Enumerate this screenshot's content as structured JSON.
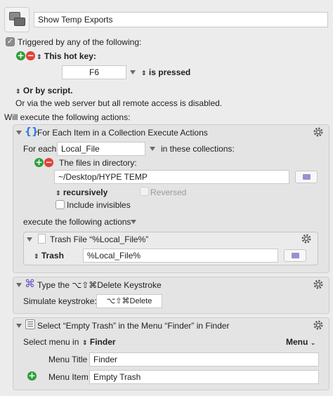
{
  "macro_name": "Show Temp Exports",
  "trigger": {
    "enabled_label": "Triggered by any of the following:",
    "hotkey_label": "This hot key:",
    "hotkey_value": "F6",
    "hotkey_state": "is pressed",
    "script_label": "Or by script.",
    "web_label": "Or via the web server but all remote access is disabled."
  },
  "actions_label": "Will execute the following actions:",
  "foreach": {
    "title": "For Each Item in a Collection Execute Actions",
    "for_each_label": "For each",
    "variable": "Local_File",
    "in_label": "in these collections:",
    "files_label": "The files in directory:",
    "directory": "~/Desktop/HYPE TEMP",
    "recursive_label": "recursively",
    "reversed_label": "Reversed",
    "invisibles_label": "Include invisibles",
    "execute_label": "execute the following actions",
    "trash": {
      "title": "Trash File “%Local_File%”",
      "label": "Trash",
      "value": "%Local_File%"
    }
  },
  "keystroke": {
    "title": "Type the ⌥⇧⌘Delete Keystroke",
    "simulate_label": "Simulate keystroke:",
    "value": "⌥⇧⌘Delete"
  },
  "menu": {
    "title": "Select “Empty Trash” in the Menu “Finder” in Finder",
    "select_label": "Select menu in",
    "app": "Finder",
    "menu_popup": "Menu",
    "menu_title_label": "Menu Title",
    "menu_title_value": "Finder",
    "menu_item_label": "Menu Item",
    "menu_item_value": "Empty Trash"
  },
  "colors": {
    "background": "#ececec",
    "plus_green": "#2e9e3a",
    "minus_red": "#e0413a",
    "foreach_blue": "#2f7be0",
    "keystroke_purple": "#6a50c8"
  }
}
